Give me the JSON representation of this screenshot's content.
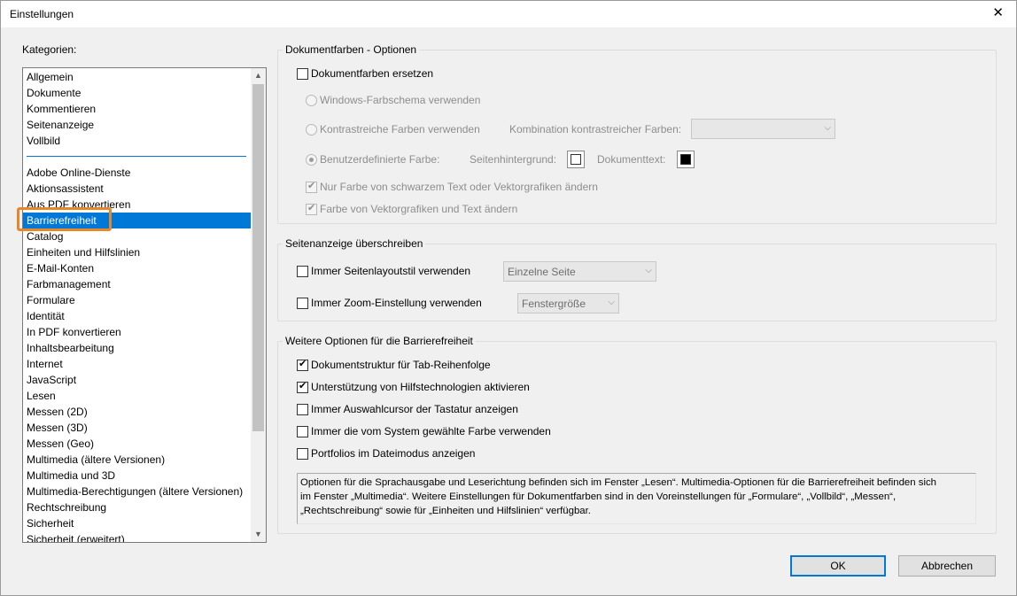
{
  "window": {
    "title": "Einstellungen",
    "close_icon": "close-icon"
  },
  "categories": {
    "label": "Kategorien:",
    "items": [
      "Allgemein",
      "Dokumente",
      "Kommentieren",
      "Seitenanzeige",
      "Vollbild",
      "Adobe Online-Dienste",
      "Aktionsassistent",
      "Aus PDF konvertieren",
      "Barrierefreiheit",
      "Catalog",
      "Einheiten und Hilfslinien",
      "E-Mail-Konten",
      "Farbmanagement",
      "Formulare",
      "Identität",
      "In PDF konvertieren",
      "Inhaltsbearbeitung",
      "Internet",
      "JavaScript",
      "Lesen",
      "Messen (2D)",
      "Messen (3D)",
      "Messen (Geo)",
      "Multimedia (ältere Versionen)",
      "Multimedia und 3D",
      "Multimedia-Berechtigungen (ältere Versionen)",
      "Rechtschreibung",
      "Sicherheit",
      "Sicherheit (erweitert)"
    ],
    "selected": "Barrierefreiheit",
    "accent_color": "#0078d7",
    "highlight_color": "#e8862a"
  },
  "doc_colors": {
    "title": "Dokumentfarben - Optionen",
    "replace": {
      "label": "Dokumentfarben ersetzen",
      "checked": false
    },
    "windows_scheme": "Windows-Farbschema verwenden",
    "high_contrast": "Kontrastreiche Farben verwenden",
    "combo_label": "Kombination kontrastreicher Farben:",
    "combo_value": "",
    "custom": "Benutzerdefinierte Farbe:",
    "page_bg_label": "Seitenhintergrund:",
    "page_bg_color": "#ffffff",
    "doc_text_label": "Dokumenttext:",
    "doc_text_color": "#000000",
    "only_black": {
      "label": "Nur Farbe von schwarzem Text oder Vektorgrafiken ändern",
      "checked": true
    },
    "vector_text": {
      "label": "Farbe von Vektorgrafiken und Text ändern",
      "checked": true
    }
  },
  "page_display": {
    "title": "Seitenanzeige überschreiben",
    "layout": {
      "label": "Immer Seitenlayoutstil verwenden",
      "checked": false,
      "value": "Einzelne Seite"
    },
    "zoom": {
      "label": "Immer Zoom-Einstellung verwenden",
      "checked": false,
      "value": "Fenstergröße"
    }
  },
  "more_options": {
    "title": "Weitere Optionen für die Barrierefreiheit",
    "items": [
      {
        "label": "Dokumentstruktur für Tab-Reihenfolge",
        "checked": true
      },
      {
        "label": "Unterstützung von Hilfstechnologien aktivieren",
        "checked": true
      },
      {
        "label": "Immer Auswahlcursor der Tastatur anzeigen",
        "checked": false
      },
      {
        "label": "Immer die vom System gewählte Farbe verwenden",
        "checked": false
      },
      {
        "label": "Portfolios im Dateimodus anzeigen",
        "checked": false
      }
    ],
    "info_lines": [
      "Optionen für die Sprachausgabe und Leserichtung befinden sich im Fenster „Lesen“. Multimedia-Optionen für die Barrierefreiheit befinden sich",
      "im Fenster „Multimedia“. Weitere Einstellungen für Dokumentfarben sind in den Voreinstellungen für „Formulare“, „Vollbild“, „Messen“,",
      "„Rechtschreibung“ sowie für „Einheiten und Hilfslinien“ verfügbar."
    ]
  },
  "buttons": {
    "ok": "OK",
    "cancel": "Abbrechen"
  }
}
